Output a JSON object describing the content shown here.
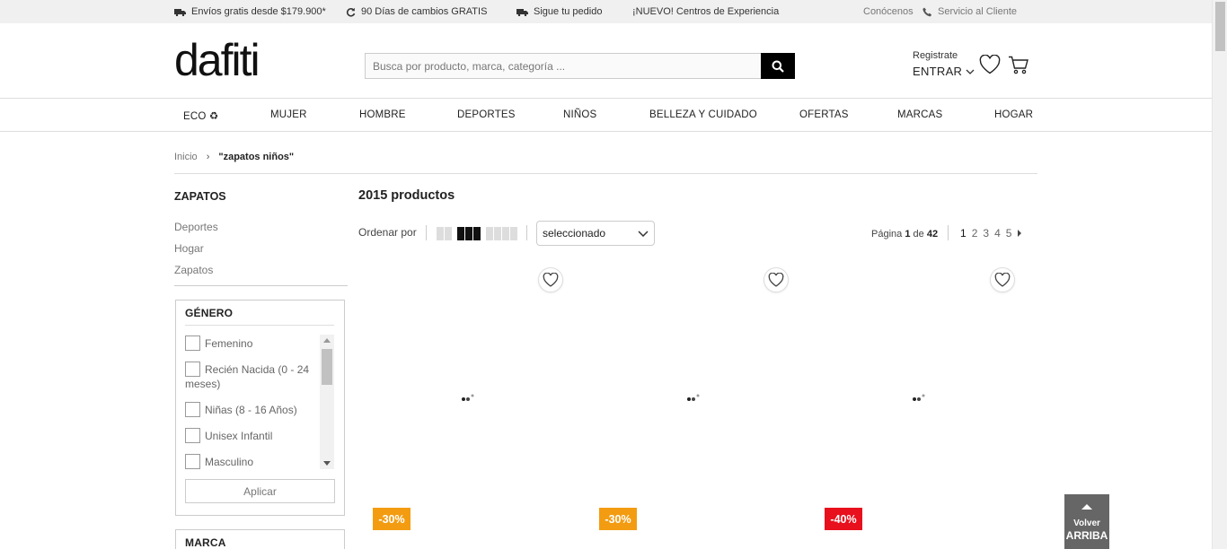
{
  "topbar": {
    "shipping": "Envíos gratis desde $179.900*",
    "returns": "90 Días de cambios GRATIS",
    "tracking": "Sigue tu pedido",
    "experience": "¡NUEVO! Centros de Experiencia",
    "about": "Conócenos",
    "service": "Servicio al Cliente"
  },
  "header": {
    "logo": "dafiti",
    "search_placeholder": "Busca por producto, marca, categoría ...",
    "register": "Registrate",
    "enter": "ENTRAR"
  },
  "nav": [
    "ECO ♻",
    "MUJER",
    "HOMBRE",
    "DEPORTES",
    "NIÑOS",
    "BELLEZA Y CUIDADO",
    "OFERTAS",
    "MARCAS",
    "HOGAR"
  ],
  "breadcrumb": {
    "home": "Inicio",
    "separator": "›",
    "current": "\"zapatos niños\""
  },
  "sidebar": {
    "title": "ZAPATOS",
    "links": [
      "Deportes",
      "Hogar",
      "Zapatos"
    ],
    "gender_filter": {
      "title": "GÉNERO",
      "options": [
        "Femenino",
        "Recién Nacida (0 - 24 meses)",
        "Niñas (8 - 16 Años)",
        "Unisex Infantil",
        "Masculino"
      ],
      "apply": "Aplicar"
    },
    "brand_filter_title": "MARCA"
  },
  "main": {
    "count": "2015 productos",
    "sort_label": "Ordenar por",
    "sort_value": "seleccionado",
    "page_prefix": "Página",
    "page_current": "1",
    "page_of": "de",
    "page_total": "42",
    "pages": [
      "1",
      "2",
      "3",
      "4",
      "5"
    ]
  },
  "products": [
    {
      "discount": "-30%",
      "badge_color": "#f39c12"
    },
    {
      "discount": "-30%",
      "badge_color": "#f39c12"
    },
    {
      "discount": "-40%",
      "badge_color": "#e8101d"
    }
  ],
  "back_to_top": {
    "line1": "Volver",
    "line2": "ARRIBA"
  },
  "icons": {
    "truck": "truck-icon",
    "refresh": "refresh-icon",
    "phone": "phone-icon",
    "search": "search-icon",
    "heart": "heart-icon",
    "cart": "cart-icon",
    "chevron": "chevron-down-icon"
  }
}
